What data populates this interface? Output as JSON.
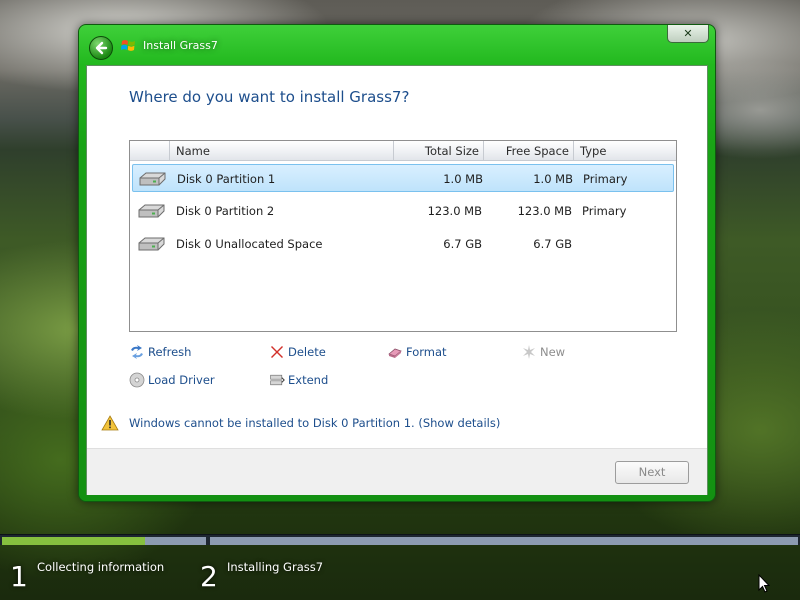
{
  "window": {
    "title": "Install Grass7",
    "close_label": "✕"
  },
  "question": "Where do you want to install Grass7?",
  "table": {
    "columns": [
      "Name",
      "Total Size",
      "Free Space",
      "Type"
    ],
    "rows": [
      {
        "name": "Disk 0 Partition 1",
        "total": "1.0 MB",
        "free": "1.0 MB",
        "type": "Primary",
        "selected": true
      },
      {
        "name": "Disk 0 Partition 2",
        "total": "123.0 MB",
        "free": "123.0 MB",
        "type": "Primary",
        "selected": false
      },
      {
        "name": "Disk 0 Unallocated Space",
        "total": "6.7 GB",
        "free": "6.7 GB",
        "type": "",
        "selected": false
      }
    ]
  },
  "actions": {
    "refresh": "Refresh",
    "delete": "Delete",
    "format": "Format",
    "new": "New",
    "load_driver": "Load Driver",
    "extend": "Extend"
  },
  "warning": {
    "message": "Windows cannot be installed to Disk 0 Partition 1.",
    "details_link": "(Show details)"
  },
  "footer": {
    "next_label": "Next"
  },
  "progress": {
    "steps": [
      {
        "number": "1",
        "label": "Collecting information"
      },
      {
        "number": "2",
        "label": "Installing Grass7"
      }
    ],
    "step1_fraction": 0.7,
    "step2_fraction": 0.0
  },
  "colors": {
    "window_frame": "#22b81e",
    "link": "#1d4e8c",
    "selection": "#bfe3fb",
    "progress_fill": "#86c03f"
  }
}
